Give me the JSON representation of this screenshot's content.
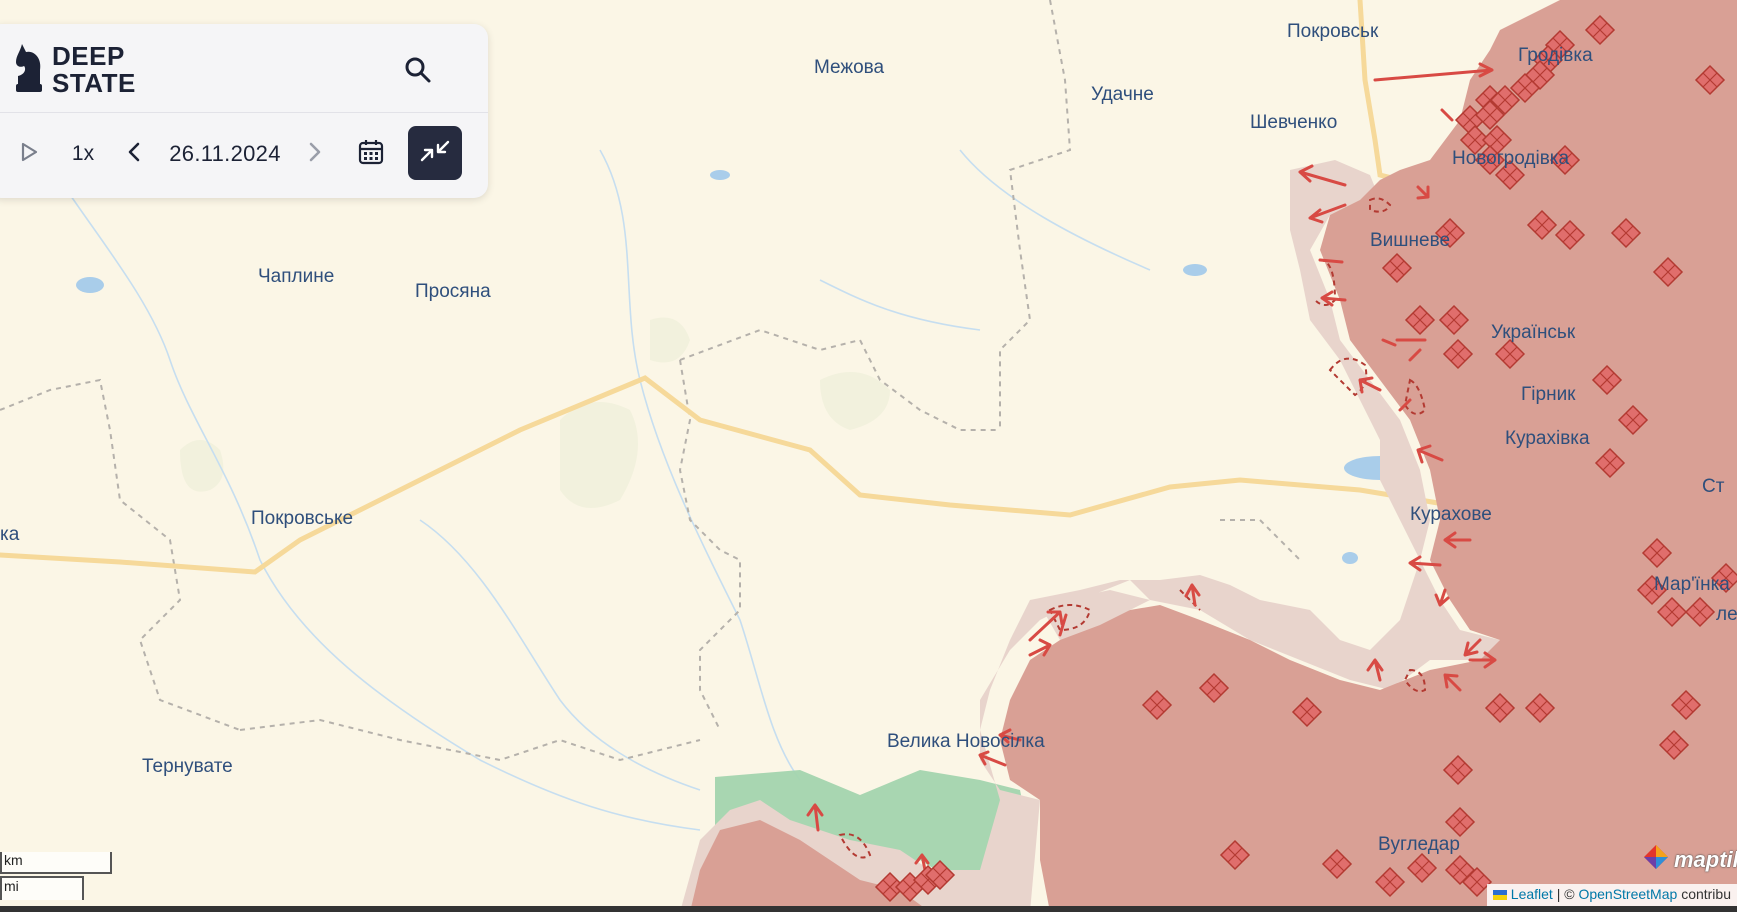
{
  "map": {
    "places": [
      {
        "id": "mezhova",
        "name": "Межова"
      },
      {
        "id": "pokrovsk",
        "name": "Покровськ"
      },
      {
        "id": "udachne",
        "name": "Удачне"
      },
      {
        "id": "shevchenko",
        "name": "Шевченко"
      },
      {
        "id": "hrodivka",
        "name": "Гродівка"
      },
      {
        "id": "novohrodivka",
        "name": "Новогродівка"
      },
      {
        "id": "vyshneve",
        "name": "Вишневе"
      },
      {
        "id": "chapline",
        "name": "Чаплине"
      },
      {
        "id": "prosiana",
        "name": "Просяна"
      },
      {
        "id": "ukrainsk",
        "name": "Українськ"
      },
      {
        "id": "hirnyk",
        "name": "Гірник"
      },
      {
        "id": "kurakhivka",
        "name": "Курахівка"
      },
      {
        "id": "stepove",
        "name": "Ст"
      },
      {
        "id": "kurakhove",
        "name": "Курахове"
      },
      {
        "id": "pokrovske",
        "name": "Покровське"
      },
      {
        "id": "ka",
        "name": "ка"
      },
      {
        "id": "marinka",
        "name": "Мар'їнка"
      },
      {
        "id": "le",
        "name": "ле"
      },
      {
        "id": "velyka_novosilka",
        "name": "Велика Новосілка"
      },
      {
        "id": "ternuvate",
        "name": "Тернувате"
      },
      {
        "id": "vuhledar",
        "name": "Вугледар"
      }
    ],
    "colors": {
      "background": "#fbf6e6",
      "occupied": "#d9a095",
      "contested_edge": "#e8d4cc",
      "liberated": "#a3d4ae",
      "markers": "#e07a78",
      "road": "#f6d99a",
      "place_label": "#2f4f7c"
    }
  },
  "panel": {
    "logo_line1": "DEEP",
    "logo_line2": "STATE",
    "speed": "1x",
    "date": "26.11.2024",
    "icons": {
      "logo": "knight-icon",
      "search": "search-icon",
      "play": "play-icon",
      "prev": "chevron-left-icon",
      "next": "chevron-right-icon",
      "calendar": "calendar-icon",
      "collapse": "collapse-arrows-icon"
    }
  },
  "scale": {
    "top_label": "km",
    "bottom_label": "mi"
  },
  "attribution": {
    "leaflet": "Leaflet",
    "separator": "| ©",
    "osm": "OpenStreetMap",
    "contrib": "contribu"
  },
  "maptiler_label": "maptiler"
}
